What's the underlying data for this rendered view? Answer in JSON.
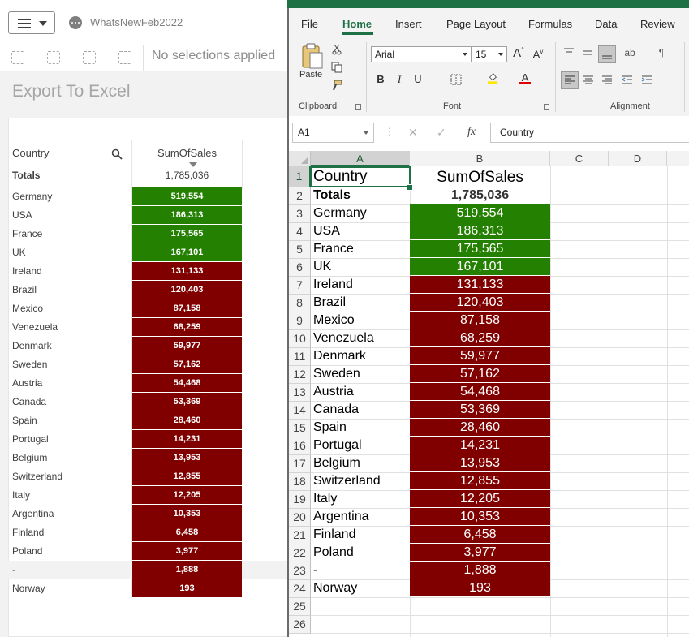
{
  "qlik": {
    "app_name": "WhatsNewFeb2022",
    "selection_text": "No selections applied",
    "sheet_title": "Export To Excel",
    "table": {
      "col_country": "Country",
      "col_sales": "SumOfSales",
      "totals_label": "Totals",
      "totals_value": "1,785,036",
      "rows": [
        {
          "country": "Germany",
          "value": "519,554",
          "status": "high"
        },
        {
          "country": "USA",
          "value": "186,313",
          "status": "high"
        },
        {
          "country": "France",
          "value": "175,565",
          "status": "high"
        },
        {
          "country": "UK",
          "value": "167,101",
          "status": "high"
        },
        {
          "country": "Ireland",
          "value": "131,133",
          "status": "low"
        },
        {
          "country": "Brazil",
          "value": "120,403",
          "status": "low"
        },
        {
          "country": "Mexico",
          "value": "87,158",
          "status": "low"
        },
        {
          "country": "Venezuela",
          "value": "68,259",
          "status": "low"
        },
        {
          "country": "Denmark",
          "value": "59,977",
          "status": "low"
        },
        {
          "country": "Sweden",
          "value": "57,162",
          "status": "low"
        },
        {
          "country": "Austria",
          "value": "54,468",
          "status": "low"
        },
        {
          "country": "Canada",
          "value": "53,369",
          "status": "low"
        },
        {
          "country": "Spain",
          "value": "28,460",
          "status": "low"
        },
        {
          "country": "Portugal",
          "value": "14,231",
          "status": "low"
        },
        {
          "country": "Belgium",
          "value": "13,953",
          "status": "low"
        },
        {
          "country": "Switzerland",
          "value": "12,855",
          "status": "low"
        },
        {
          "country": "Italy",
          "value": "12,205",
          "status": "low"
        },
        {
          "country": "Argentina",
          "value": "10,353",
          "status": "low"
        },
        {
          "country": "Finland",
          "value": "6,458",
          "status": "low"
        },
        {
          "country": "Poland",
          "value": "3,977",
          "status": "low"
        },
        {
          "country": "-",
          "value": "1,888",
          "status": "low"
        },
        {
          "country": "Norway",
          "value": "193",
          "status": "low"
        }
      ]
    }
  },
  "colors": {
    "high": "#238000",
    "low": "#800000",
    "excel_green": "#1e7145"
  },
  "excel": {
    "tabs": [
      "File",
      "Home",
      "Insert",
      "Page Layout",
      "Formulas",
      "Data",
      "Review"
    ],
    "groups": {
      "clipboard": "Clipboard",
      "font": "Font",
      "alignment": "Alignment",
      "paste": "Paste"
    },
    "font_name": "Arial",
    "font_size": "15",
    "name_box": "A1",
    "formula_value": "Country",
    "fx_label": "fx",
    "columns": [
      "A",
      "B",
      "C",
      "D"
    ],
    "row_numbers": [
      "1",
      "2",
      "3",
      "4",
      "5",
      "6",
      "7",
      "8",
      "9",
      "10",
      "11",
      "12",
      "13",
      "14",
      "15",
      "16",
      "17",
      "18",
      "19",
      "20",
      "21",
      "22",
      "23",
      "24",
      "25",
      "26"
    ],
    "header_a": "Country",
    "header_b": "SumOfSales",
    "totals_a": "Totals",
    "totals_b": "1,785,036"
  }
}
